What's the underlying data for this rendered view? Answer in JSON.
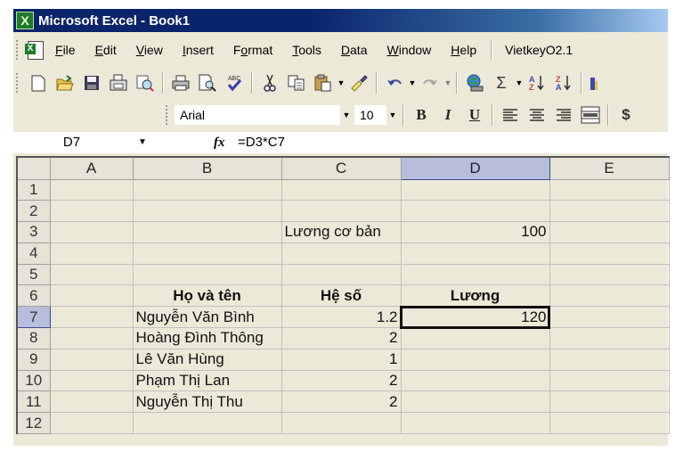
{
  "window": {
    "title": "Microsoft Excel - Book1"
  },
  "menu": {
    "items": [
      {
        "label": "File",
        "key": "F"
      },
      {
        "label": "Edit",
        "key": "E"
      },
      {
        "label": "View",
        "key": "V"
      },
      {
        "label": "Insert",
        "key": "I"
      },
      {
        "label": "Format",
        "key": "o"
      },
      {
        "label": "Tools",
        "key": "T"
      },
      {
        "label": "Data",
        "key": "D"
      },
      {
        "label": "Window",
        "key": "W"
      },
      {
        "label": "Help",
        "key": "H"
      }
    ],
    "extra": "VietkeyO2.1"
  },
  "standard_toolbar": {
    "icons": [
      "new-icon",
      "open-icon",
      "save-icon",
      "permission-icon",
      "research-icon",
      "print-icon",
      "print-preview-icon",
      "spelling-icon",
      "cut-icon",
      "copy-icon",
      "paste-icon",
      "format-painter-icon",
      "undo-icon",
      "redo-icon",
      "hyperlink-icon",
      "autosum-icon",
      "sort-ascending-icon",
      "sort-descending-icon",
      "chart-wizard-icon"
    ],
    "glyphs": {
      "autosum": "Σ",
      "sort_asc_top": "A",
      "sort_asc_bottom": "Z",
      "sort_desc_top": "Z",
      "sort_desc_bottom": "A"
    }
  },
  "formatting_toolbar": {
    "font_name": "Arial",
    "font_size": "10",
    "bold": "B",
    "italic": "I",
    "underline": "U",
    "currency": "$"
  },
  "formula_bar": {
    "name_box": "D7",
    "fx_label": "fx",
    "formula": "=D3*C7"
  },
  "sheet": {
    "columns": [
      "A",
      "B",
      "C",
      "D",
      "E"
    ],
    "selected_column": "D",
    "selected_row": 7,
    "active_cell": "D7",
    "rows": [
      {
        "n": "1",
        "A": "",
        "B": "",
        "C": "",
        "D": "",
        "E": ""
      },
      {
        "n": "2",
        "A": "",
        "B": "",
        "C": "",
        "D": "",
        "E": ""
      },
      {
        "n": "3",
        "A": "",
        "B": "",
        "C": "Lương cơ bản",
        "D": "100",
        "E": ""
      },
      {
        "n": "4",
        "A": "",
        "B": "",
        "C": "",
        "D": "",
        "E": ""
      },
      {
        "n": "5",
        "A": "",
        "B": "",
        "C": "",
        "D": "",
        "E": ""
      },
      {
        "n": "6",
        "A": "",
        "B": "Họ và tên",
        "C": "Hệ số",
        "D": "Lương",
        "E": ""
      },
      {
        "n": "7",
        "A": "",
        "B": "Nguyễn Văn Bình",
        "C": "1.2",
        "D": "120",
        "E": ""
      },
      {
        "n": "8",
        "A": "",
        "B": "Hoàng Đình Thông",
        "C": "2",
        "D": "",
        "E": ""
      },
      {
        "n": "9",
        "A": "",
        "B": "Lê Văn Hùng",
        "C": "1",
        "D": "",
        "E": ""
      },
      {
        "n": "10",
        "A": "",
        "B": "Phạm Thị Lan",
        "C": "2",
        "D": "",
        "E": ""
      },
      {
        "n": "11",
        "A": "",
        "B": "Nguyễn Thị Thu",
        "C": "2",
        "D": "",
        "E": ""
      },
      {
        "n": "12",
        "A": "",
        "B": "",
        "C": "",
        "D": "",
        "E": ""
      }
    ]
  },
  "colors": {
    "title_bar": "#0a246a",
    "chrome": "#ece9d8",
    "selected_header": "#b6bedc",
    "excel_green": "#1f7a2a"
  }
}
